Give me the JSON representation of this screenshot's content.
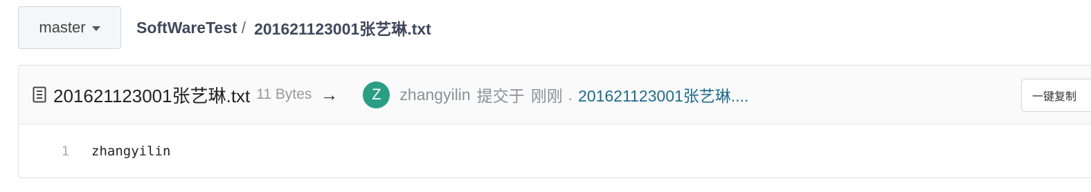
{
  "branch": {
    "label": "master",
    "icon": "caret-down-icon"
  },
  "breadcrumb": {
    "repo": "SoftWareTest",
    "separator": "/",
    "file": "201621123001张艺琳.txt"
  },
  "file_header": {
    "icon": "file-text-icon",
    "name": "201621123001张艺琳.txt",
    "size": "11 Bytes",
    "arrow": "→",
    "avatar_letter": "Z",
    "avatar_color": "#2a9e84",
    "author": "zhangyilin",
    "verb": "提交于",
    "time": "刚刚",
    "dot": ".",
    "commit_message": "201621123001张艺琳....",
    "copy_button": "一键复制"
  },
  "code": {
    "lines": [
      {
        "number": "1",
        "text": "zhangyilin"
      }
    ]
  }
}
